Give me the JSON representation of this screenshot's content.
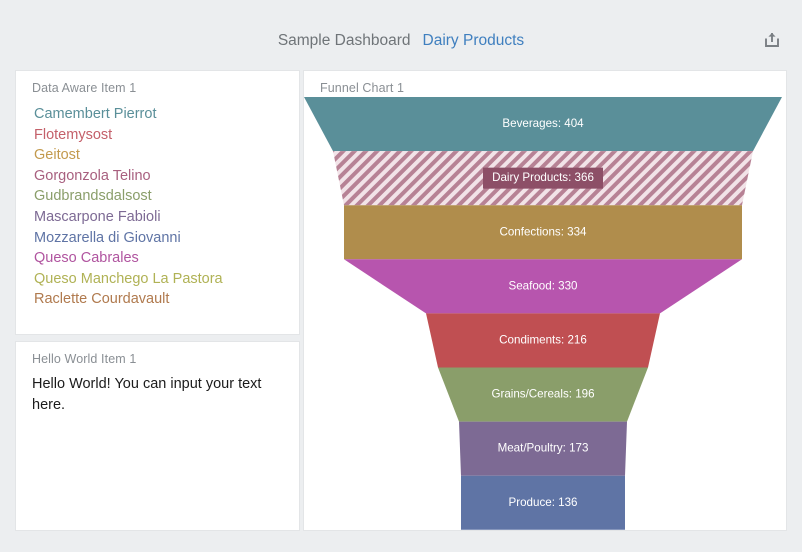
{
  "header": {
    "title": "Sample Dashboard",
    "subtitle": "Dairy Products",
    "export_icon": "share-export-icon"
  },
  "panels": {
    "data_aware": {
      "title": "Data Aware Item 1",
      "items": [
        {
          "label": "Camembert Pierrot",
          "color": "#5a8f99"
        },
        {
          "label": "Flotemysost",
          "color": "#c4606a"
        },
        {
          "label": "Geitost",
          "color": "#c39a4e"
        },
        {
          "label": "Gorgonzola Telino",
          "color": "#a8607f"
        },
        {
          "label": "Gudbrandsdalsost",
          "color": "#8a9e6a"
        },
        {
          "label": "Mascarpone Fabioli",
          "color": "#7d6a94"
        },
        {
          "label": "Mozzarella di Giovanni",
          "color": "#5f74a5"
        },
        {
          "label": "Queso Cabrales",
          "color": "#b0549f"
        },
        {
          "label": "Queso Manchego La Pastora",
          "color": "#b0b255"
        },
        {
          "label": "Raclette Courdavault",
          "color": "#b07a4e"
        }
      ]
    },
    "hello_world": {
      "title": "Hello World Item 1",
      "text": "Hello World! You can input your text here."
    },
    "funnel": {
      "title": "Funnel Chart 1"
    }
  },
  "chart_data": {
    "type": "funnel",
    "title": "Funnel Chart 1",
    "xlabel": "",
    "ylabel": "",
    "selected": "Dairy Products",
    "label_format": "{category}: {value}",
    "categories": [
      "Beverages",
      "Dairy Products",
      "Confections",
      "Seafood",
      "Condiments",
      "Grains/Cereals",
      "Meat/Poultry",
      "Produce"
    ],
    "values": [
      404,
      366,
      334,
      330,
      216,
      196,
      173,
      136
    ],
    "segments": [
      {
        "label": "Beverages: 404",
        "category": "Beverages",
        "value": 404,
        "color": "#5a8f99",
        "selected": false
      },
      {
        "label": "Dairy Products: 366",
        "category": "Dairy Products",
        "value": 366,
        "color": "#8d4f67",
        "selected": true
      },
      {
        "label": "Confections: 334",
        "category": "Confections",
        "value": 334,
        "color": "#b08d4c",
        "selected": false
      },
      {
        "label": "Seafood: 330",
        "category": "Seafood",
        "value": 330,
        "color": "#b755ae",
        "selected": false
      },
      {
        "label": "Condiments: 216",
        "category": "Condiments",
        "value": 216,
        "color": "#c04f52",
        "selected": false
      },
      {
        "label": "Grains/Cereals: 196",
        "category": "Grains/Cereals",
        "value": 196,
        "color": "#8a9e6a",
        "selected": false
      },
      {
        "label": "Meat/Poultry: 173",
        "category": "Meat/Poultry",
        "value": 173,
        "color": "#7d6a94",
        "selected": false
      },
      {
        "label": "Produce: 136",
        "category": "Produce",
        "value": 136,
        "color": "#5f74a5",
        "selected": false
      }
    ]
  }
}
